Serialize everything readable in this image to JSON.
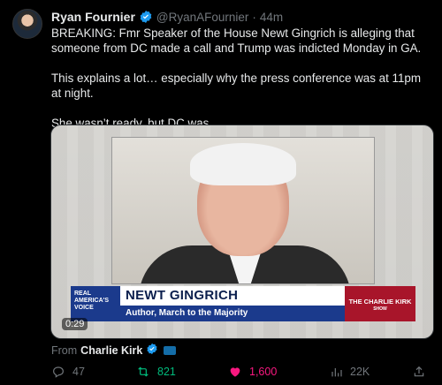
{
  "author": {
    "name": "Ryan Fournier",
    "handle": "@RyanAFournier",
    "separator": "·",
    "time": "44m"
  },
  "tweet_text": {
    "p1": "BREAKING: Fmr Speaker of the House Newt Gingrich is alleging that someone from DC made a call and Trump was indicted Monday in GA.",
    "p2": "This explains a lot… especially why the press conference was at 11pm at night.",
    "p3": "She wasn’t ready, but DC was."
  },
  "media": {
    "network_logo": "REAL AMERICA'S VOICE",
    "lower_third_name": "NEWT GINGRICH",
    "lower_third_title": "Author, March to the Majority",
    "show_name": "THE CHARLIE KIRK",
    "show_sub": "SHOW",
    "duration": "0:29"
  },
  "source": {
    "prefix": "From",
    "name": "Charlie Kirk"
  },
  "actions": {
    "replies": "47",
    "retweets": "821",
    "likes": "1,600",
    "views": "22K"
  },
  "colors": {
    "verified": "#1d9bf0",
    "retweet_active": "#00ba7c",
    "like_active": "#f91880",
    "muted": "#71767b"
  },
  "icons": [
    "verified-badge-icon",
    "reply-icon",
    "retweet-icon",
    "heart-icon",
    "views-icon",
    "share-icon"
  ]
}
